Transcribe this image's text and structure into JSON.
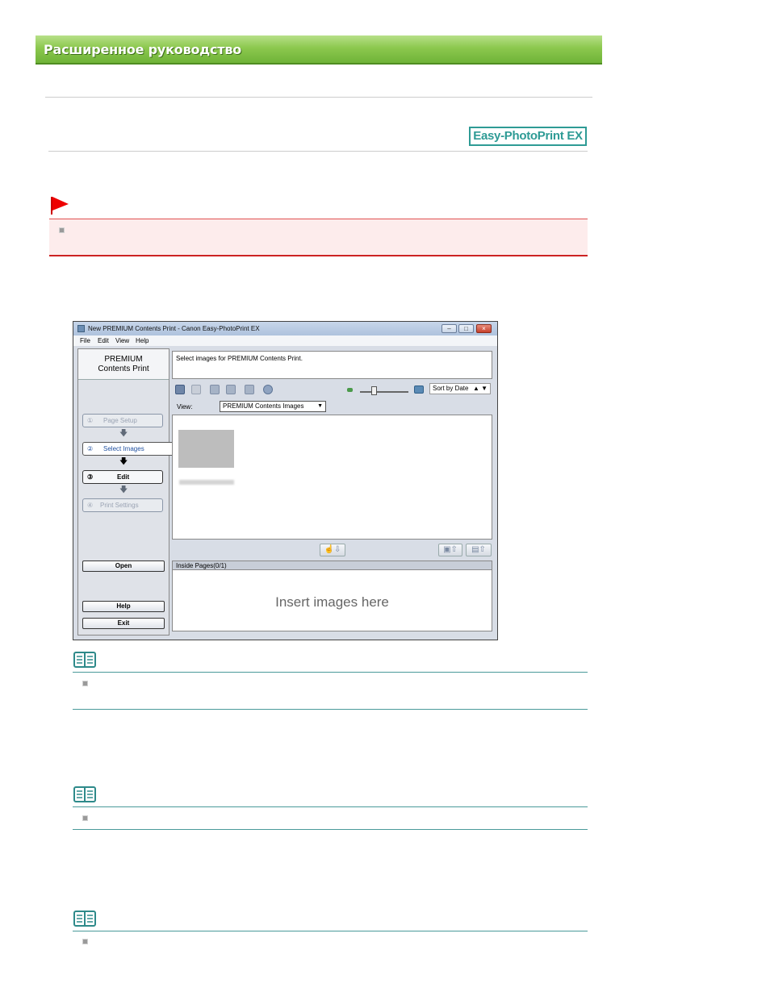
{
  "header": {
    "banner_title": "Расширенное руководство"
  },
  "product_logo": "Easy-PhotoPrint EX",
  "screenshot": {
    "window_title": "New PREMIUM Contents Print - Canon Easy-PhotoPrint EX",
    "window_buttons": {
      "minimize": "–",
      "maximize": "□",
      "close": "×"
    },
    "menu": [
      "File",
      "Edit",
      "View",
      "Help"
    ],
    "left_panel": {
      "title_line1": "PREMIUM",
      "title_line2": "Contents Print",
      "steps": [
        {
          "num": "①",
          "label": "Page Setup"
        },
        {
          "num": "②",
          "label": "Select Images"
        },
        {
          "num": "③",
          "label": "Edit"
        },
        {
          "num": "④",
          "label": "Print Settings"
        }
      ],
      "arrow": "🡇",
      "open_button": "Open",
      "help_button": "Help",
      "exit_button": "Exit"
    },
    "instruction": "Select images for PREMIUM Contents Print.",
    "sort_select": "Sort by Date",
    "sort_arrows": "▲ ▼",
    "view_label": "View:",
    "view_select": "PREMIUM Contents Images",
    "view_caret": "▼",
    "inside_pages_label": "Inside Pages(0/1)",
    "insert_placeholder": "Insert images here",
    "mid_buttons": {
      "add": "☝⇩",
      "remove_one": "▣⇧",
      "remove_all": "▤⇧"
    }
  },
  "colors": {
    "banner": "#8cc84e",
    "logo": "#2e9b95",
    "important_bg": "#fdecec",
    "important_border": "#cc2222",
    "note_rule": "#4a9a9a"
  }
}
